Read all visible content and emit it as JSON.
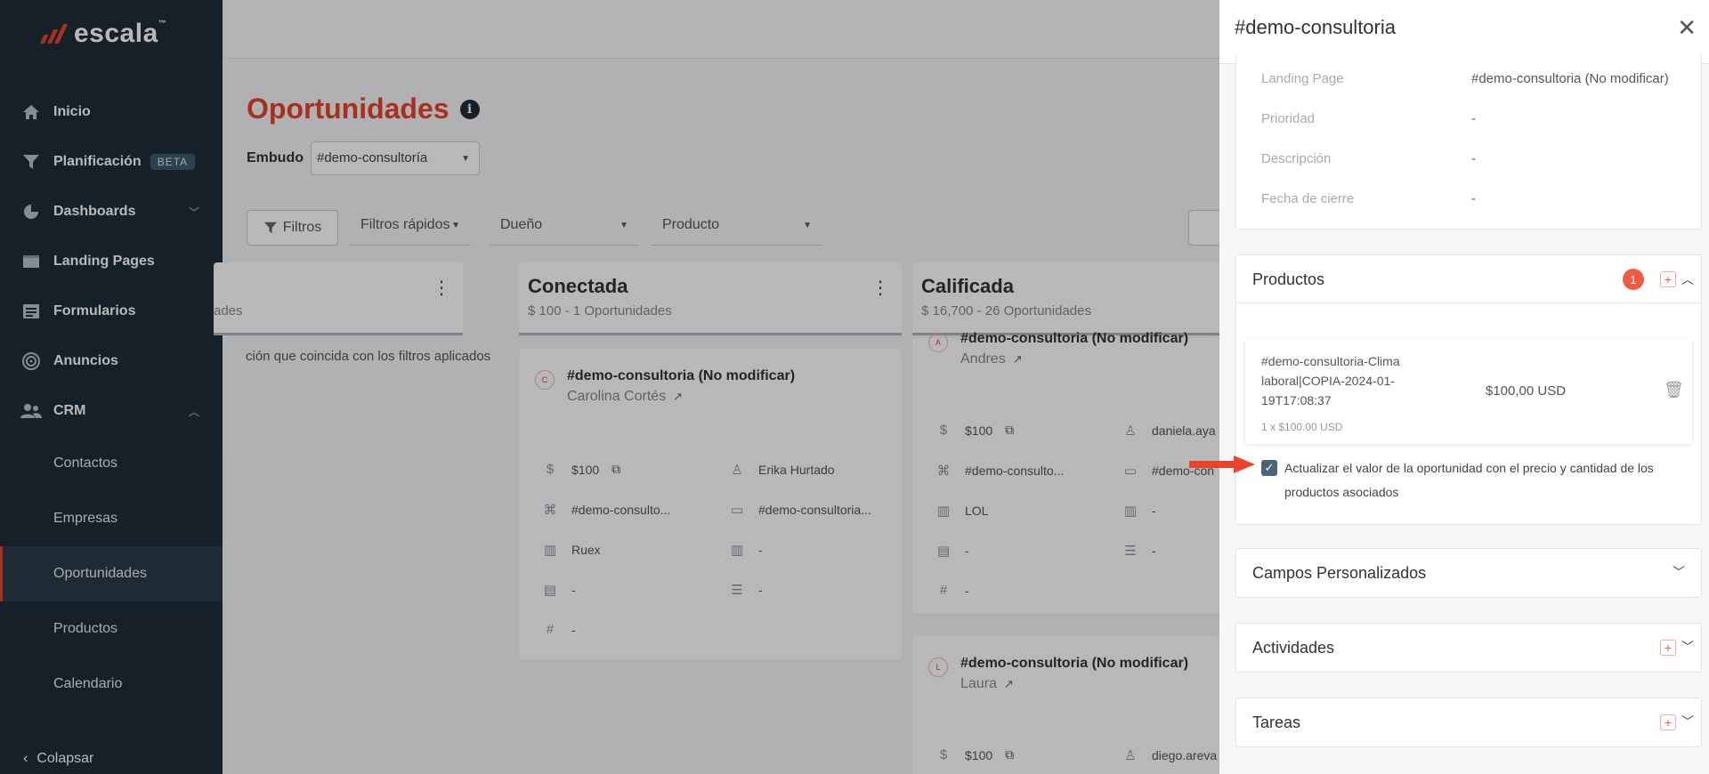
{
  "brand": {
    "name": "escala",
    "tm": "™"
  },
  "sidebar": {
    "items": [
      {
        "label": "Inicio",
        "icon": "home-icon"
      },
      {
        "label": "Planificación",
        "icon": "filter-icon",
        "badge": "BETA"
      },
      {
        "label": "Dashboards",
        "icon": "pie-chart-icon"
      },
      {
        "label": "Landing Pages",
        "icon": "folder-icon"
      },
      {
        "label": "Formularios",
        "icon": "form-icon"
      },
      {
        "label": "Anuncios",
        "icon": "target-icon"
      },
      {
        "label": "CRM",
        "icon": "users-icon"
      }
    ],
    "crm_sub": [
      "Contactos",
      "Empresas",
      "Oportunidades",
      "Productos",
      "Calendario"
    ],
    "collapse_label": "Colapsar"
  },
  "main": {
    "title": "Oportunidades",
    "embudo_label": "Embudo",
    "embudo_value": "#demo-consultoría",
    "filters_label": "Filtros",
    "quick_filters": "Filtros rápidos",
    "owner_placeholder": "Dueño",
    "product_placeholder": "Producto",
    "col0_sub": "ades",
    "empty_text": "ción que coincida con los filtros aplicados",
    "columns": [
      {
        "title": "Conectada",
        "sub": "$ 100 - 1 Oportunidades"
      },
      {
        "title": "Calificada",
        "sub": "$ 16,700 - 26 Oportunidades"
      }
    ],
    "cards": [
      {
        "avatar": "C",
        "name": "#demo-consultoria (No modificar)",
        "owner": "Carolina Cortés",
        "amount": "$100",
        "user": "Erika Hurtado",
        "f1": "#demo-consulto...",
        "f2": "#demo-consultoria...",
        "f3": "Ruex",
        "f4": "-",
        "f5": "-",
        "f6": "-",
        "f7": "-"
      },
      {
        "avatar": "A",
        "name": "#demo-consultoria (No modificar)",
        "owner": "Andres",
        "amount": "$100",
        "user": "daniela.aya",
        "f1": "#demo-consulto...",
        "f2": "#demo-con",
        "f3": "LOL",
        "f4": "-",
        "f5": "-",
        "f6": "-",
        "f7": "-"
      },
      {
        "avatar": "L",
        "name": "#demo-consultoria (No modificar)",
        "owner": "Laura",
        "amount": "$100",
        "user": "diego.areva"
      }
    ]
  },
  "drawer": {
    "title": "#demo-consultoria",
    "details": [
      {
        "label": "Landing Page",
        "value": "#demo-consultoria (No modificar)"
      },
      {
        "label": "Prioridad",
        "value": "-"
      },
      {
        "label": "Descripción",
        "value": "-"
      },
      {
        "label": "Fecha de cierre",
        "value": "-"
      }
    ],
    "products": {
      "title": "Productos",
      "count": "1",
      "item_name": "#demo-consultoria-Clima laboral|COPIA-2024-01-19T17:08:37",
      "item_qty": "1 x $100.00 USD",
      "item_price": "$100,00 USD",
      "checkbox_label": "Actualizar el valor de la oportunidad con el precio y cantidad de los productos asociados"
    },
    "sections": [
      "Campos Personalizados",
      "Actividades",
      "Tareas"
    ]
  },
  "colors": {
    "accent": "#e8452c",
    "sidebar": "#1e2d3a",
    "checkbox": "#4a6578"
  }
}
